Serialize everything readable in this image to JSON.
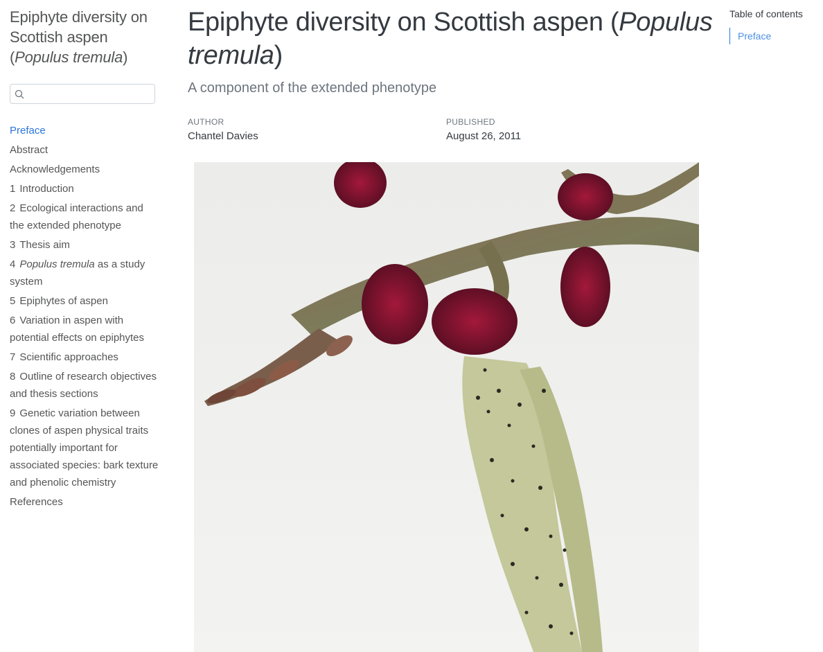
{
  "sidebar": {
    "title_main": "Epiphyte diversity on Scottish aspen (",
    "title_italic": "Populus tremula",
    "title_end": ")",
    "search_placeholder": "",
    "items": [
      {
        "num": "",
        "label": "Preface",
        "active": true
      },
      {
        "num": "",
        "label": "Abstract"
      },
      {
        "num": "",
        "label": "Acknowledgements"
      },
      {
        "num": "1",
        "label": "Introduction"
      },
      {
        "num": "2",
        "label": "Ecological interactions and the extended phenotype"
      },
      {
        "num": "3",
        "label": "Thesis aim"
      },
      {
        "num": "4",
        "label_italic": "Populus tremula",
        "label": " as a study system"
      },
      {
        "num": "5",
        "label": "Epiphytes of aspen"
      },
      {
        "num": "6",
        "label": "Variation in aspen with potential effects on epiphytes"
      },
      {
        "num": "7",
        "label": "Scientific approaches"
      },
      {
        "num": "8",
        "label": "Outline of research objectives and thesis sections"
      },
      {
        "num": "9",
        "label": "Genetic variation between clones of aspen physical traits potentially important for associated species: bark texture and phenolic chemistry"
      },
      {
        "num": "",
        "label": "References"
      }
    ]
  },
  "main": {
    "title_main": "Epiphyte diversity on Scottish aspen (",
    "title_italic": "Populus tremula",
    "title_end": ")",
    "subtitle": "A component of the extended phenotype",
    "author_label": "AUTHOR",
    "author": "Chantel Davies",
    "published_label": "PUBLISHED",
    "published": "August 26, 2011"
  },
  "toc": {
    "title": "Table of contents",
    "items": [
      "Preface"
    ]
  },
  "colors": {
    "accent": "#2a76dd",
    "text": "#343a40",
    "muted": "#6c757d"
  }
}
